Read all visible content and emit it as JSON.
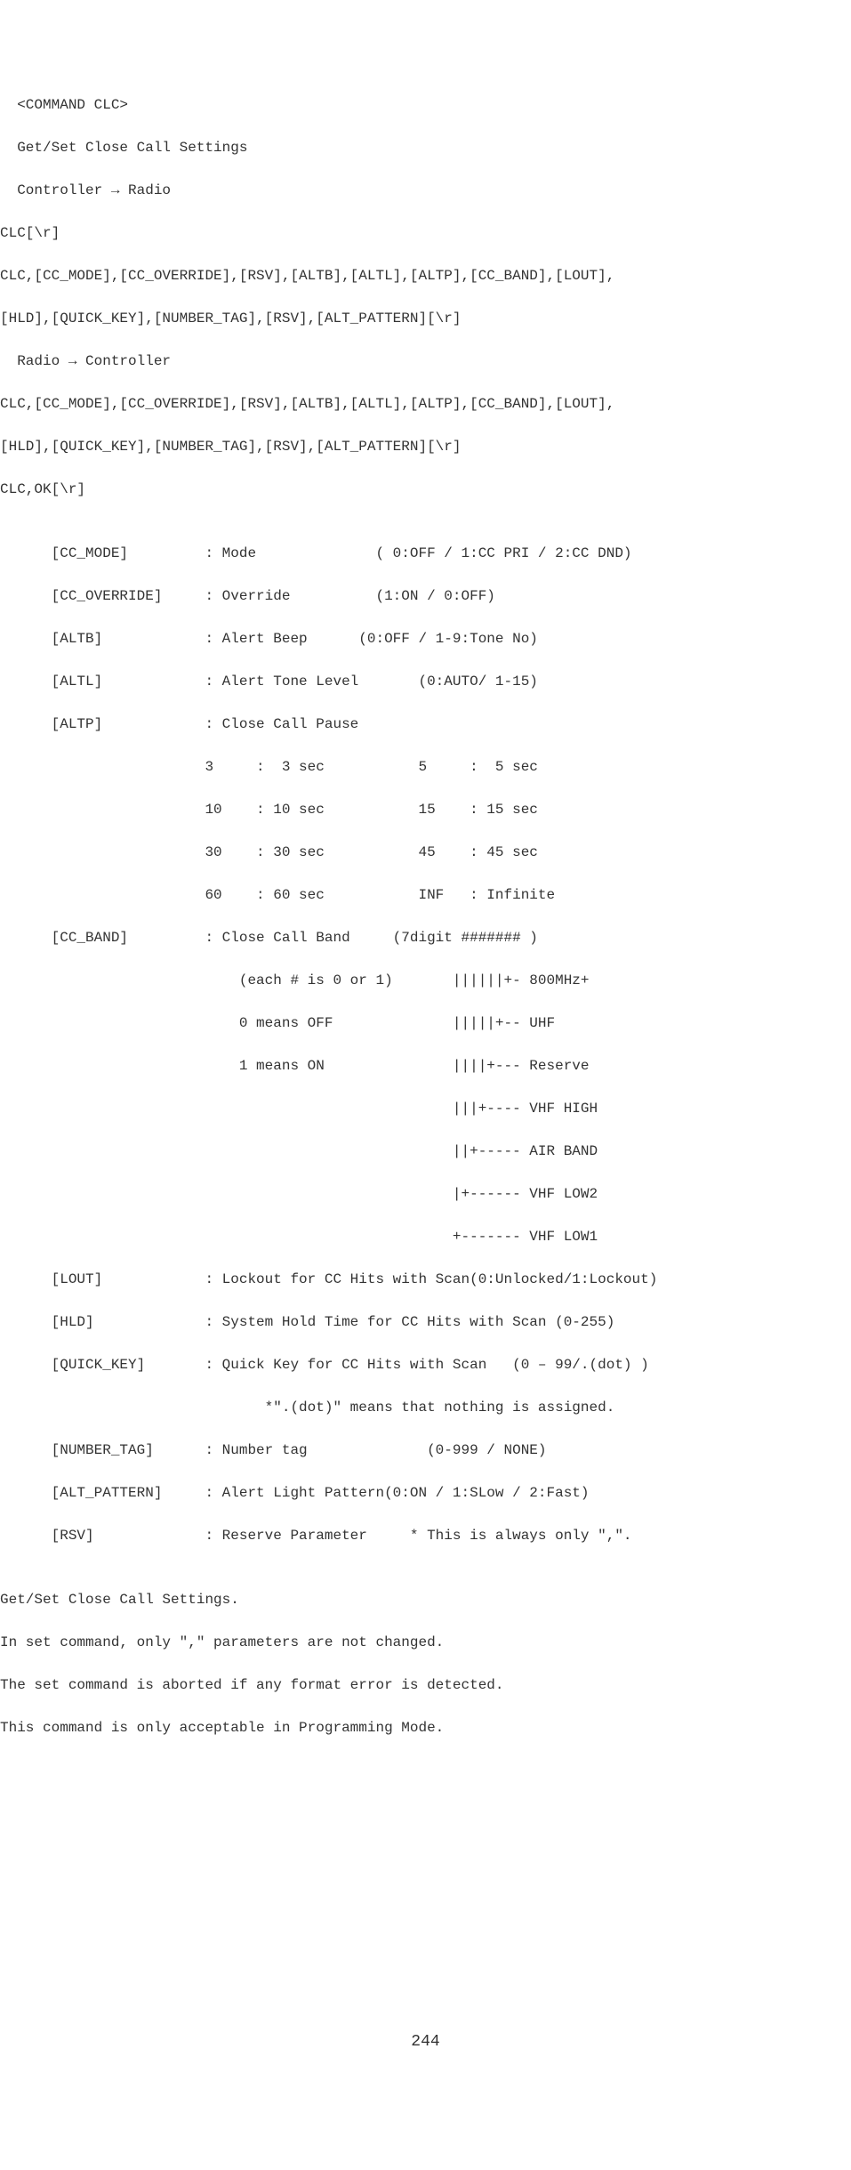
{
  "line1": "  <COMMAND CLC>",
  "line2": "  Get/Set Close Call Settings",
  "line3": "  Controller → Radio",
  "line4": "CLC[\\r]",
  "line5": "CLC,[CC_MODE],[CC_OVERRIDE],[RSV],[ALTB],[ALTL],[ALTP],[CC_BAND],[LOUT],",
  "line6": "[HLD],[QUICK_KEY],[NUMBER_TAG],[RSV],[ALT_PATTERN][\\r]",
  "line7": "  Radio → Controller",
  "line8": "CLC,[CC_MODE],[CC_OVERRIDE],[RSV],[ALTB],[ALTL],[ALTP],[CC_BAND],[LOUT],",
  "line9": "[HLD],[QUICK_KEY],[NUMBER_TAG],[RSV],[ALT_PATTERN][\\r]",
  "line10": "CLC,OK[\\r]",
  "blank1": "",
  "p_cc_mode": "      [CC_MODE]         : Mode              ( 0:OFF / 1:CC PRI / 2:CC DND)",
  "p_cc_override": "      [CC_OVERRIDE]     : Override          (1:ON / 0:OFF)",
  "p_altb": "      [ALTB]            : Alert Beep      (0:OFF / 1-9:Tone No)",
  "p_altl": "      [ALTL]            : Alert Tone Level       (0:AUTO/ 1-15)",
  "p_altp": "      [ALTP]            : Close Call Pause",
  "p_altp_row1": "                        3     :  3 sec           5     :  5 sec",
  "p_altp_row2": "                        10    : 10 sec           15    : 15 sec",
  "p_altp_row3": "                        30    : 30 sec           45    : 45 sec",
  "p_altp_row4": "                        60    : 60 sec           INF   : Infinite",
  "p_cc_band": "      [CC_BAND]         : Close Call Band     (7digit ####### )",
  "p_band1": "                            (each # is 0 or 1)       ||||||+- 800MHz+",
  "p_band2": "                            0 means OFF              |||||+-- UHF",
  "p_band3": "                            1 means ON               ||||+--- Reserve",
  "p_band4": "                                                     |||+---- VHF HIGH",
  "p_band5": "                                                     ||+----- AIR BAND",
  "p_band6": "                                                     |+------ VHF LOW2",
  "p_band7": "                                                     +------- VHF LOW1",
  "p_lout": "      [LOUT]            : Lockout for CC Hits with Scan(0:Unlocked/1:Lockout)",
  "p_hld": "      [HLD]             : System Hold Time for CC Hits with Scan (0-255)",
  "p_quick_key": "      [QUICK_KEY]       : Quick Key for CC Hits with Scan   (0 – 99/.(dot) )",
  "p_quick_key2": "                               *\".(dot)\" means that nothing is assigned.",
  "p_number_tag": "      [NUMBER_TAG]      : Number tag              (0-999 / NONE)",
  "p_alt_pattern": "      [ALT_PATTERN]     : Alert Light Pattern(0:ON / 1:SLow / 2:Fast)",
  "p_rsv": "      [RSV]             : Reserve Parameter     * This is always only \",\".",
  "blank2": "",
  "note1": "Get/Set Close Call Settings.",
  "note2": "In set command, only \",\" parameters are not changed.",
  "note3": "The set command is aborted if any format error is detected.",
  "note4": "This command is only acceptable in Programming Mode.",
  "page_number": "244"
}
